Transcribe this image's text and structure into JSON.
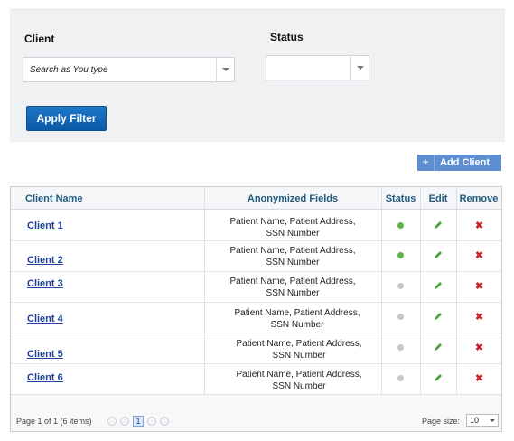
{
  "filters": {
    "client_label": "Client",
    "client_placeholder": "Search as You type",
    "status_label": "Status",
    "status_value": "",
    "apply_label": "Apply Filter"
  },
  "toolbar": {
    "add_label": "Add Client"
  },
  "grid": {
    "columns": [
      "Client Name",
      "Anonymized Fields",
      "Status",
      "Edit",
      "Remove"
    ],
    "rows": [
      {
        "name": "Client 1",
        "fields_line1": "Patient Name, Patient Address,",
        "fields_line2": "SSN Number",
        "status": "active"
      },
      {
        "name": "Client 2",
        "fields_line1": "Patient Name, Patient Address,",
        "fields_line2": "SSN Number",
        "status": "active"
      },
      {
        "name": "Client 3",
        "fields_line1": "Patient Name, Patient Address,",
        "fields_line2": "SSN Number",
        "status": "inactive"
      },
      {
        "name": "Client 4",
        "fields_line1": "Patient Name, Patient Address,",
        "fields_line2": "SSN Number",
        "status": "inactive"
      },
      {
        "name": "Client 5",
        "fields_line1": "Patient Name, Patient Address,",
        "fields_line2": "SSN Number",
        "status": "inactive"
      },
      {
        "name": "Client 6",
        "fields_line1": "Patient Name, Patient Address,",
        "fields_line2": "SSN Number",
        "status": "inactive"
      }
    ],
    "remove_glyph": "✖"
  },
  "pager": {
    "info": "Page 1 of 1 (6 items)",
    "current_page": "1",
    "page_size_label": "Page size:",
    "page_size_value": "10"
  },
  "colors": {
    "active": "#5cb544",
    "inactive": "#c4c7cc",
    "edit": "#4aa83a",
    "remove": "#c0272d",
    "accent": "#0b5aa6"
  }
}
